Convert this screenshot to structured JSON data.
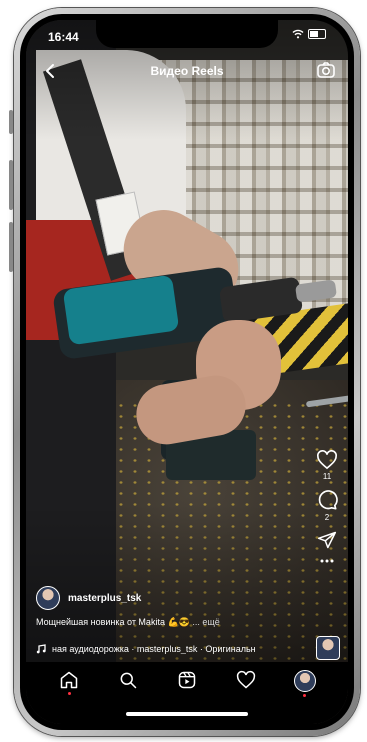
{
  "status_bar": {
    "time": "16:44"
  },
  "header": {
    "title": "Видео Reels",
    "back_icon": "arrow-back-icon",
    "camera_icon": "camera-icon"
  },
  "actions": {
    "likes": "11",
    "comments": "2"
  },
  "post": {
    "username": "masterplus_tsk",
    "caption": "Мощнейшая новинка от Makita 💪😎",
    "caption_more": "... ещё",
    "audio_text": "ная аудиодорожка · masterplus_tsk · Оригинальн"
  },
  "nav": {
    "items": [
      "home-icon",
      "search-icon",
      "reels-icon",
      "heart-icon",
      "profile-avatar"
    ]
  },
  "colors": {
    "notification_dot": "#ff3040",
    "background": "#000000",
    "text": "#ffffff"
  }
}
